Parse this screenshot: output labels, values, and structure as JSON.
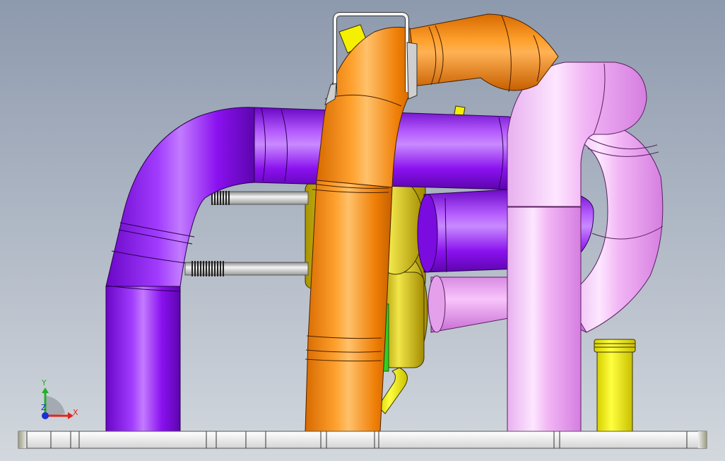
{
  "viewport": {
    "background_top": "#8d99ad",
    "background_bottom": "#d3d8de"
  },
  "triad": {
    "x_label": "X",
    "y_label": "Y",
    "z_label": "Z",
    "x_color": "#e0261c",
    "y_color": "#22b02a",
    "z_color": "#1b2fd6"
  },
  "parts": [
    {
      "name": "purple-pipe",
      "color": "#8a11ef"
    },
    {
      "name": "orange-pipe",
      "color": "#f0860d"
    },
    {
      "name": "pink-pipe",
      "color": "#e895ef"
    },
    {
      "name": "yellow-turbo-housing",
      "color": "#e7dc18"
    },
    {
      "name": "yellow-standpipe",
      "color": "#f4f000"
    },
    {
      "name": "silver-bracket",
      "color": "#e6e6e6"
    },
    {
      "name": "spring-rods",
      "color": "#d0d0d0"
    },
    {
      "name": "base-plate",
      "color": "#ececec"
    },
    {
      "name": "green-flange",
      "color": "#2ed11d"
    }
  ]
}
